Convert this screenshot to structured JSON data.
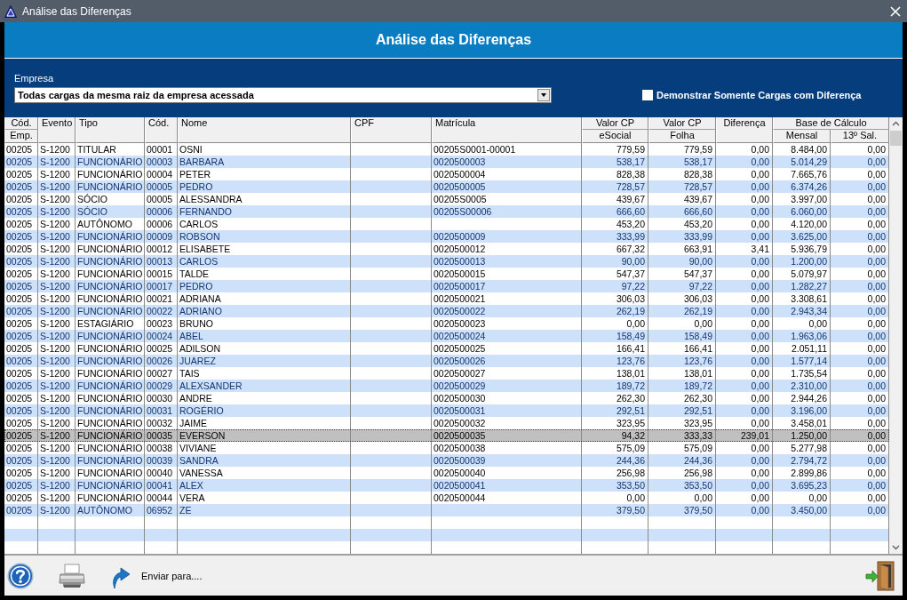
{
  "window": {
    "title": "Análise das Diferenças"
  },
  "heading": "Análise das Diferenças",
  "filter": {
    "label": "Empresa",
    "value": "Todas cargas da mesma raiz da empresa acessada"
  },
  "only_differences": {
    "label": "Demonstrar Somente Cargas com Diferença",
    "checked": false
  },
  "table": {
    "columns": [
      {
        "kind": "stacked",
        "label": "Cód.",
        "sublabel": "Emp."
      },
      {
        "kind": "single",
        "label": "Evento"
      },
      {
        "kind": "single",
        "label": "Tipo"
      },
      {
        "kind": "single",
        "label": "Cód."
      },
      {
        "kind": "single",
        "label": "Nome"
      },
      {
        "kind": "single",
        "label": "CPF"
      },
      {
        "kind": "single",
        "label": "Matrícula"
      },
      {
        "kind": "stacked",
        "label": "Valor CP",
        "sublabel": "eSocial"
      },
      {
        "kind": "stacked",
        "label": "Valor CP",
        "sublabel": "Folha"
      },
      {
        "kind": "single",
        "label": "Diferença"
      },
      {
        "kind": "group",
        "label": "Base de Cálculo",
        "subcolumns": [
          "Mensal",
          "13º Sal."
        ]
      }
    ],
    "rows": [
      {
        "cod_emp": "00205",
        "evento": "S-1200",
        "tipo": "TITULAR",
        "cod": "00001",
        "nome": "OSNI",
        "matricula": "00205S0001-00001",
        "valor_cp_esocial": "779,59",
        "valor_cp_folha": "779,59",
        "diferenca": "0,00",
        "base_calculo_mensal": "8.484,00",
        "base_calculo_13_sal": "0,00",
        "selected": false
      },
      {
        "cod_emp": "00205",
        "evento": "S-1200",
        "tipo": "FUNCIONÁRIO",
        "cod": "00003",
        "nome": "BARBARA",
        "matricula": "0020500003",
        "valor_cp_esocial": "538,17",
        "valor_cp_folha": "538,17",
        "diferenca": "0,00",
        "base_calculo_mensal": "5.014,29",
        "base_calculo_13_sal": "0,00",
        "selected": false
      },
      {
        "cod_emp": "00205",
        "evento": "S-1200",
        "tipo": "FUNCIONÁRIO",
        "cod": "00004",
        "nome": "PETER",
        "matricula": "0020500004",
        "valor_cp_esocial": "828,38",
        "valor_cp_folha": "828,38",
        "diferenca": "0,00",
        "base_calculo_mensal": "7.665,76",
        "base_calculo_13_sal": "0,00",
        "selected": false
      },
      {
        "cod_emp": "00205",
        "evento": "S-1200",
        "tipo": "FUNCIONÁRIO",
        "cod": "00005",
        "nome": "PEDRO",
        "matricula": "0020500005",
        "valor_cp_esocial": "728,57",
        "valor_cp_folha": "728,57",
        "diferenca": "0,00",
        "base_calculo_mensal": "6.374,26",
        "base_calculo_13_sal": "0,00",
        "selected": false
      },
      {
        "cod_emp": "00205",
        "evento": "S-1200",
        "tipo": "SÓCIO",
        "cod": "00005",
        "nome": "ALESSANDRA",
        "matricula": "00205S0005",
        "valor_cp_esocial": "439,67",
        "valor_cp_folha": "439,67",
        "diferenca": "0,00",
        "base_calculo_mensal": "3.997,00",
        "base_calculo_13_sal": "0,00",
        "selected": false
      },
      {
        "cod_emp": "00205",
        "evento": "S-1200",
        "tipo": "SÓCIO",
        "cod": "00006",
        "nome": "FERNANDO",
        "matricula": "00205S00006",
        "valor_cp_esocial": "666,60",
        "valor_cp_folha": "666,60",
        "diferenca": "0,00",
        "base_calculo_mensal": "6.060,00",
        "base_calculo_13_sal": "0,00",
        "selected": false
      },
      {
        "cod_emp": "00205",
        "evento": "S-1200",
        "tipo": "AUTÔNOMO",
        "cod": "00006",
        "nome": "CARLOS",
        "valor_cp_esocial": "453,20",
        "valor_cp_folha": "453,20",
        "diferenca": "0,00",
        "base_calculo_mensal": "4.120,00",
        "base_calculo_13_sal": "0,00",
        "selected": false
      },
      {
        "cod_emp": "00205",
        "evento": "S-1200",
        "tipo": "FUNCIONÁRIO",
        "cod": "00009",
        "nome": "ROBSON",
        "matricula": "0020500009",
        "valor_cp_esocial": "333,99",
        "valor_cp_folha": "333,99",
        "diferenca": "0,00",
        "base_calculo_mensal": "3.625,00",
        "base_calculo_13_sal": "0,00",
        "selected": false
      },
      {
        "cod_emp": "00205",
        "evento": "S-1200",
        "tipo": "FUNCIONÁRIO",
        "cod": "00012",
        "nome": "ELISABETE",
        "matricula": "0020500012",
        "valor_cp_esocial": "667,32",
        "valor_cp_folha": "663,91",
        "diferenca": "3,41",
        "base_calculo_mensal": "5.936,79",
        "base_calculo_13_sal": "0,00",
        "selected": false
      },
      {
        "cod_emp": "00205",
        "evento": "S-1200",
        "tipo": "FUNCIONÁRIO",
        "cod": "00013",
        "nome": "CARLOS",
        "matricula": "0020500013",
        "valor_cp_esocial": "90,00",
        "valor_cp_folha": "90,00",
        "diferenca": "0,00",
        "base_calculo_mensal": "1.200,00",
        "base_calculo_13_sal": "0,00",
        "selected": false
      },
      {
        "cod_emp": "00205",
        "evento": "S-1200",
        "tipo": "FUNCIONÁRIO",
        "cod": "00015",
        "nome": "TALDE",
        "matricula": "0020500015",
        "valor_cp_esocial": "547,37",
        "valor_cp_folha": "547,37",
        "diferenca": "0,00",
        "base_calculo_mensal": "5.079,97",
        "base_calculo_13_sal": "0,00",
        "selected": false
      },
      {
        "cod_emp": "00205",
        "evento": "S-1200",
        "tipo": "FUNCIONÁRIO",
        "cod": "00017",
        "nome": "PEDRO",
        "matricula": "0020500017",
        "valor_cp_esocial": "97,22",
        "valor_cp_folha": "97,22",
        "diferenca": "0,00",
        "base_calculo_mensal": "1.282,27",
        "base_calculo_13_sal": "0,00",
        "selected": false
      },
      {
        "cod_emp": "00205",
        "evento": "S-1200",
        "tipo": "FUNCIONÁRIO",
        "cod": "00021",
        "nome": "ADRIANA",
        "matricula": "0020500021",
        "valor_cp_esocial": "306,03",
        "valor_cp_folha": "306,03",
        "diferenca": "0,00",
        "base_calculo_mensal": "3.308,61",
        "base_calculo_13_sal": "0,00",
        "selected": false
      },
      {
        "cod_emp": "00205",
        "evento": "S-1200",
        "tipo": "FUNCIONÁRIO",
        "cod": "00022",
        "nome": "ADRIANO",
        "matricula": "0020500022",
        "valor_cp_esocial": "262,19",
        "valor_cp_folha": "262,19",
        "diferenca": "0,00",
        "base_calculo_mensal": "2.943,34",
        "base_calculo_13_sal": "0,00",
        "selected": false
      },
      {
        "cod_emp": "00205",
        "evento": "S-1200",
        "tipo": "ESTAGIÁRIO",
        "cod": "00023",
        "nome": "BRUNO",
        "matricula": "0020500023",
        "valor_cp_esocial": "0,00",
        "valor_cp_folha": "0,00",
        "diferenca": "0,00",
        "base_calculo_mensal": "0,00",
        "base_calculo_13_sal": "0,00",
        "selected": false
      },
      {
        "cod_emp": "00205",
        "evento": "S-1200",
        "tipo": "FUNCIONÁRIO",
        "cod": "00024",
        "nome": "ABEL",
        "matricula": "0020500024",
        "valor_cp_esocial": "158,49",
        "valor_cp_folha": "158,49",
        "diferenca": "0,00",
        "base_calculo_mensal": "1.963,06",
        "base_calculo_13_sal": "0,00",
        "selected": false
      },
      {
        "cod_emp": "00205",
        "evento": "S-1200",
        "tipo": "FUNCIONÁRIO",
        "cod": "00025",
        "nome": "ADILSON",
        "matricula": "0020500025",
        "valor_cp_esocial": "166,41",
        "valor_cp_folha": "166,41",
        "diferenca": "0,00",
        "base_calculo_mensal": "2.051,11",
        "base_calculo_13_sal": "0,00",
        "selected": false
      },
      {
        "cod_emp": "00205",
        "evento": "S-1200",
        "tipo": "FUNCIONÁRIO",
        "cod": "00026",
        "nome": "JUAREZ",
        "matricula": "0020500026",
        "valor_cp_esocial": "123,76",
        "valor_cp_folha": "123,76",
        "diferenca": "0,00",
        "base_calculo_mensal": "1.577,14",
        "base_calculo_13_sal": "0,00",
        "selected": false
      },
      {
        "cod_emp": "00205",
        "evento": "S-1200",
        "tipo": "FUNCIONÁRIO",
        "cod": "00027",
        "nome": "TAIS",
        "matricula": "0020500027",
        "valor_cp_esocial": "138,01",
        "valor_cp_folha": "138,01",
        "diferenca": "0,00",
        "base_calculo_mensal": "1.735,54",
        "base_calculo_13_sal": "0,00",
        "selected": false
      },
      {
        "cod_emp": "00205",
        "evento": "S-1200",
        "tipo": "FUNCIONÁRIO",
        "cod": "00029",
        "nome": "ALEXSANDER",
        "matricula": "0020500029",
        "valor_cp_esocial": "189,72",
        "valor_cp_folha": "189,72",
        "diferenca": "0,00",
        "base_calculo_mensal": "2.310,00",
        "base_calculo_13_sal": "0,00",
        "selected": false
      },
      {
        "cod_emp": "00205",
        "evento": "S-1200",
        "tipo": "FUNCIONÁRIO",
        "cod": "00030",
        "nome": "ANDRE",
        "matricula": "0020500030",
        "valor_cp_esocial": "262,30",
        "valor_cp_folha": "262,30",
        "diferenca": "0,00",
        "base_calculo_mensal": "2.944,26",
        "base_calculo_13_sal": "0,00",
        "selected": false
      },
      {
        "cod_emp": "00205",
        "evento": "S-1200",
        "tipo": "FUNCIONÁRIO",
        "cod": "00031",
        "nome": "ROGÉRIO",
        "matricula": "0020500031",
        "valor_cp_esocial": "292,51",
        "valor_cp_folha": "292,51",
        "diferenca": "0,00",
        "base_calculo_mensal": "3.196,00",
        "base_calculo_13_sal": "0,00",
        "selected": false
      },
      {
        "cod_emp": "00205",
        "evento": "S-1200",
        "tipo": "FUNCIONÁRIO",
        "cod": "00032",
        "nome": "JAIME",
        "matricula": "0020500032",
        "valor_cp_esocial": "323,95",
        "valor_cp_folha": "323,95",
        "diferenca": "0,00",
        "base_calculo_mensal": "3.458,01",
        "base_calculo_13_sal": "0,00",
        "selected": false
      },
      {
        "cod_emp": "00205",
        "evento": "S-1200",
        "tipo": "FUNCIONÁRIO",
        "cod": "00035",
        "nome": "EVERSON",
        "matricula": "0020500035",
        "valor_cp_esocial": "94,32",
        "valor_cp_folha": "333,33",
        "diferenca": "239,01",
        "base_calculo_mensal": "1.250,00",
        "base_calculo_13_sal": "0,00",
        "selected": true
      },
      {
        "cod_emp": "00205",
        "evento": "S-1200",
        "tipo": "FUNCIONÁRIO",
        "cod": "00038",
        "nome": "VIVIANE",
        "matricula": "0020500038",
        "valor_cp_esocial": "575,09",
        "valor_cp_folha": "575,09",
        "diferenca": "0,00",
        "base_calculo_mensal": "5.277,98",
        "base_calculo_13_sal": "0,00",
        "selected": false
      },
      {
        "cod_emp": "00205",
        "evento": "S-1200",
        "tipo": "FUNCIONÁRIO",
        "cod": "00039",
        "nome": "SANDRA",
        "matricula": "0020500039",
        "valor_cp_esocial": "244,36",
        "valor_cp_folha": "244,36",
        "diferenca": "0,00",
        "base_calculo_mensal": "2.794,72",
        "base_calculo_13_sal": "0,00",
        "selected": false
      },
      {
        "cod_emp": "00205",
        "evento": "S-1200",
        "tipo": "FUNCIONÁRIO",
        "cod": "00040",
        "nome": "VANESSA",
        "matricula": "0020500040",
        "valor_cp_esocial": "256,98",
        "valor_cp_folha": "256,98",
        "diferenca": "0,00",
        "base_calculo_mensal": "2.899,86",
        "base_calculo_13_sal": "0,00",
        "selected": false
      },
      {
        "cod_emp": "00205",
        "evento": "S-1200",
        "tipo": "FUNCIONÁRIO",
        "cod": "00041",
        "nome": "ALEX",
        "matricula": "0020500041",
        "valor_cp_esocial": "353,50",
        "valor_cp_folha": "353,50",
        "diferenca": "0,00",
        "base_calculo_mensal": "3.695,23",
        "base_calculo_13_sal": "0,00",
        "selected": false
      },
      {
        "cod_emp": "00205",
        "evento": "S-1200",
        "tipo": "FUNCIONÁRIO",
        "cod": "00044",
        "nome": "VERA",
        "matricula": "0020500044",
        "valor_cp_esocial": "0,00",
        "valor_cp_folha": "0,00",
        "diferenca": "0,00",
        "base_calculo_mensal": "0,00",
        "base_calculo_13_sal": "0,00",
        "selected": false
      },
      {
        "cod_emp": "00205",
        "evento": "S-1200",
        "tipo": "AUTÔNOMO",
        "cod": "06952",
        "nome": "ZE",
        "valor_cp_esocial": "379,50",
        "valor_cp_folha": "379,50",
        "diferenca": "0,00",
        "base_calculo_mensal": "3.450,00",
        "base_calculo_13_sal": "0,00",
        "selected": false
      }
    ]
  },
  "footer": {
    "send_label": "Enviar para...."
  }
}
